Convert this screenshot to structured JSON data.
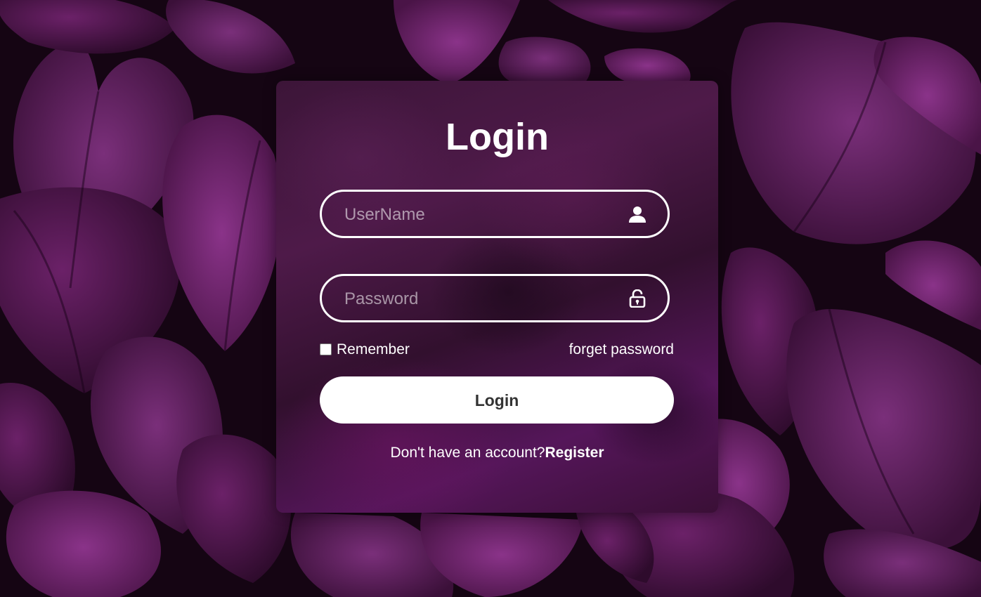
{
  "login": {
    "title": "Login",
    "username_placeholder": "UserName",
    "password_placeholder": "Password",
    "remember_label": "Remember",
    "remember_checked": false,
    "forget_label": "forget password",
    "submit_label": "Login",
    "no_account_text": "Don't have an account?",
    "register_label": "Register"
  },
  "icons": {
    "username": "user-icon",
    "password": "lock-icon"
  },
  "colors": {
    "text": "#ffffff",
    "button_bg": "#ffffff",
    "button_text": "#333333",
    "card_tint": "#4e1a49",
    "leaf_purple": "#5c1f5c"
  }
}
